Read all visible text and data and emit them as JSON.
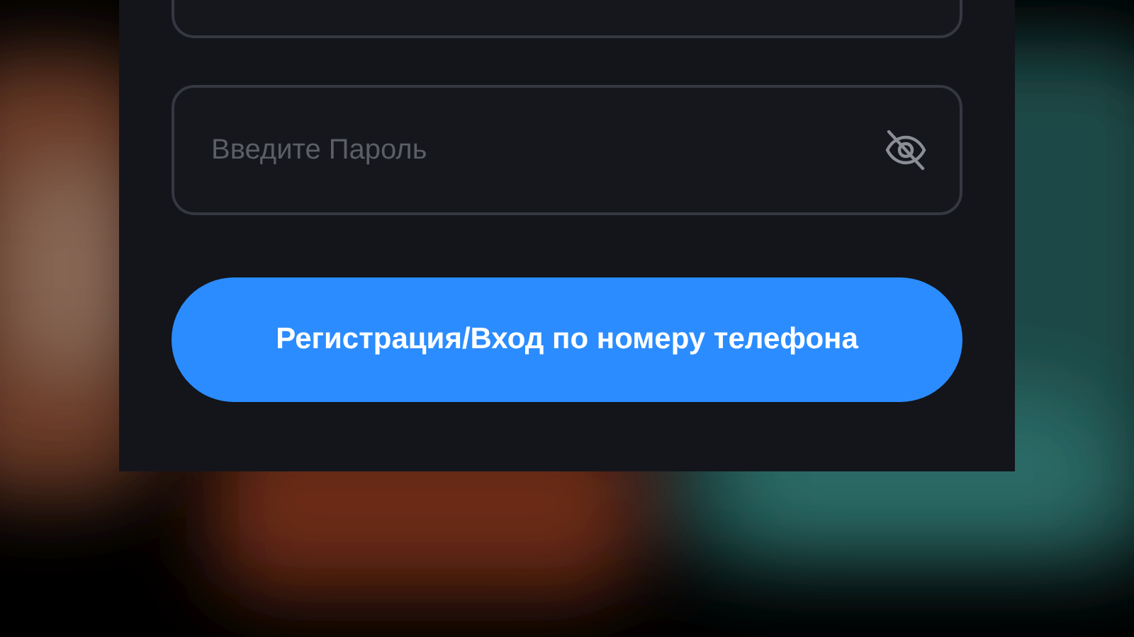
{
  "form": {
    "fields": [
      {
        "kind": "text"
      },
      {
        "kind": "password",
        "placeholder": "Введите Пароль"
      }
    ],
    "button": {
      "label": "Регистрация/Вход по номеру телефона"
    }
  }
}
